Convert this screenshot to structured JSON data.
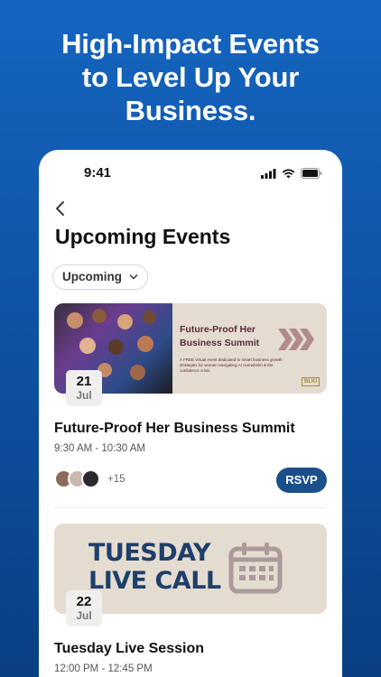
{
  "headline": [
    "High-Impact Events",
    "to Level Up Your",
    "Business."
  ],
  "status_bar": {
    "time": "9:41"
  },
  "page_title": "Upcoming Events",
  "filter": {
    "label": "Upcoming"
  },
  "events": [
    {
      "banner": {
        "title_line1": "Future-Proof Her",
        "title_line2": "Business Summit",
        "blurb": "A FREE virtual event dedicated to smart business growth strategies for women navigating AI overwhelm & the confidence crisis.",
        "brand_mark": "BLKI"
      },
      "date_day": "21",
      "date_month": "Jul",
      "title": "Future-Proof Her Business Summit",
      "time": "9:30 AM - 10:30 AM",
      "attendee_more": "+15",
      "rsvp_label": "RSVP"
    },
    {
      "banner": {
        "text_line1": "TUESDAY",
        "text_line2": "LIVE CALL"
      },
      "date_day": "22",
      "date_month": "Jul",
      "title": "Tuesday Live Session",
      "time": "12:00 PM - 12:45 PM"
    }
  ],
  "colors": {
    "accent": "#1b4f8a",
    "background": "#1565c0"
  }
}
